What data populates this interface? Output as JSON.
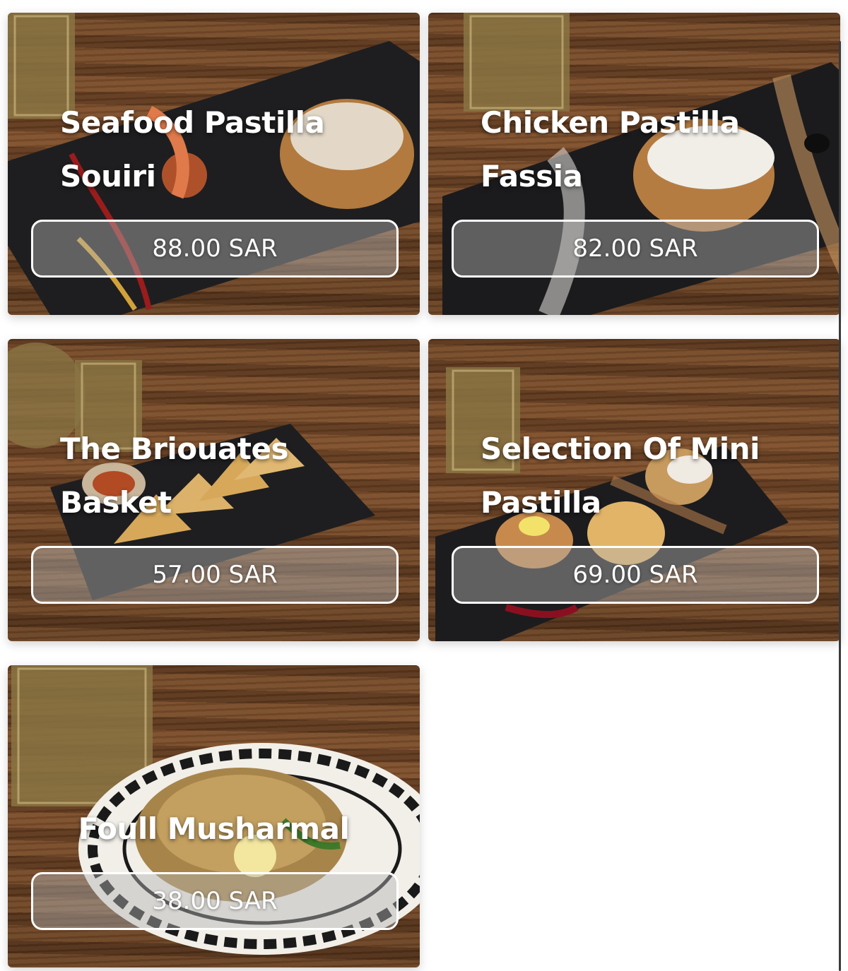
{
  "menu": {
    "items": [
      {
        "name": "Seafood Pastilla Souiri",
        "price": "88.00 SAR"
      },
      {
        "name": "Chicken Pastilla Fassia",
        "price": "82.00 SAR"
      },
      {
        "name": "The Briouates Basket",
        "price": "57.00 SAR"
      },
      {
        "name": "Selection Of Mini Pastilla",
        "price": "69.00 SAR"
      },
      {
        "name": "Foull Musharmal",
        "price": "38.00 SAR"
      }
    ]
  },
  "colors": {
    "wood": "#6b4426",
    "slate": "#1c1c1e",
    "price_border": "#ffffff",
    "title_text": "#ffffff"
  },
  "icons": [
    "glass-image",
    "plate-image",
    "food-image"
  ]
}
